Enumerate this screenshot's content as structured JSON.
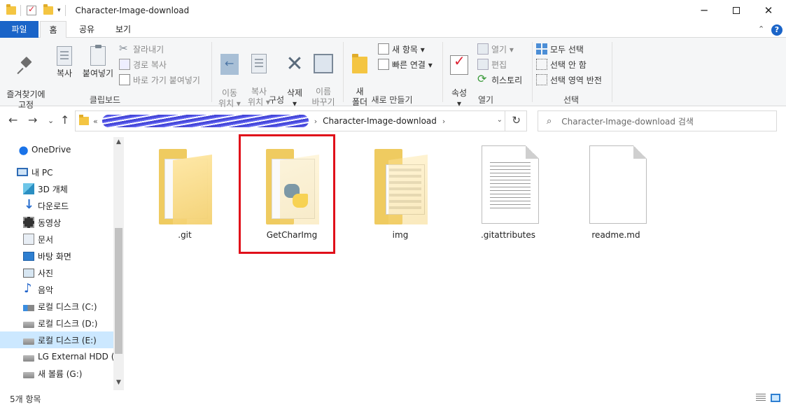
{
  "window": {
    "title": "Character-Image-download",
    "minimize": "─",
    "close": "✕"
  },
  "tabs": {
    "file": "파일",
    "home": "홈",
    "share": "공유",
    "view": "보기"
  },
  "ribbon": {
    "clipboard": {
      "pin": "즐겨찾기에\n고정",
      "copy": "복사",
      "paste": "붙여넣기",
      "cut": "잘라내기",
      "copy_path": "경로 복사",
      "paste_shortcut": "바로 가기 붙여넣기",
      "label": "클립보드"
    },
    "organize": {
      "move_to": "이동\n위치 ▾",
      "copy_to": "복사\n위치 ▾",
      "delete": "삭제\n▾",
      "rename": "이름\n바꾸기",
      "label": "구성"
    },
    "new": {
      "new_folder": "새\n폴더",
      "new_item": "새 항목 ▾",
      "easy_access": "빠른 연결 ▾",
      "label": "새로 만들기"
    },
    "open": {
      "properties": "속성\n▾",
      "open": "열기 ▾",
      "edit": "편집",
      "history": "히스토리",
      "label": "열기"
    },
    "select": {
      "select_all": "모두 선택",
      "select_none": "선택 안 함",
      "invert": "선택 영역 반전",
      "label": "선택"
    }
  },
  "address": {
    "prefix": "«",
    "current": "Character-Image-download",
    "crumb_arrow": "›",
    "dropdown": "⌄",
    "refresh": "↻"
  },
  "nav": {
    "back": "←",
    "forward": "→",
    "recent": "⌄",
    "up": "↑"
  },
  "search": {
    "placeholder": "Character-Image-download 검색",
    "icon": "⌕"
  },
  "sidebar": {
    "items": [
      {
        "label": "OneDrive",
        "icon": "cloud-icon"
      },
      {
        "label": "내 PC",
        "icon": "pc-icon"
      },
      {
        "label": "3D 개체",
        "icon": "3d-objects-icon"
      },
      {
        "label": "다운로드",
        "icon": "downloads-icon"
      },
      {
        "label": "동영상",
        "icon": "video-icon"
      },
      {
        "label": "문서",
        "icon": "documents-icon"
      },
      {
        "label": "바탕 화면",
        "icon": "desktop-icon"
      },
      {
        "label": "사진",
        "icon": "pictures-icon"
      },
      {
        "label": "음악",
        "icon": "music-icon"
      },
      {
        "label": "로컬 디스크 (C:)",
        "icon": "drive-c-icon"
      },
      {
        "label": "로컬 디스크 (D:)",
        "icon": "drive-icon"
      },
      {
        "label": "로컬 디스크 (E:)",
        "icon": "drive-icon",
        "selected": true
      },
      {
        "label": "LG External HDD (F:",
        "icon": "drive-icon"
      },
      {
        "label": "새 볼륨 (G:)",
        "icon": "drive-icon"
      }
    ],
    "scroll_up": "▲",
    "scroll_down": "▼"
  },
  "files": [
    {
      "name": ".git",
      "type": "folder"
    },
    {
      "name": "GetCharImg",
      "type": "folder-python",
      "highlighted": true
    },
    {
      "name": "img",
      "type": "folder-images"
    },
    {
      "name": ".gitattributes",
      "type": "text-file"
    },
    {
      "name": "readme.md",
      "type": "blank-file"
    }
  ],
  "status": {
    "count": "5개 항목"
  },
  "colors": {
    "accent": "#1a64c8",
    "selection": "#cce8ff",
    "highlight_box": "#e0101a",
    "folder": "#f4c542"
  }
}
